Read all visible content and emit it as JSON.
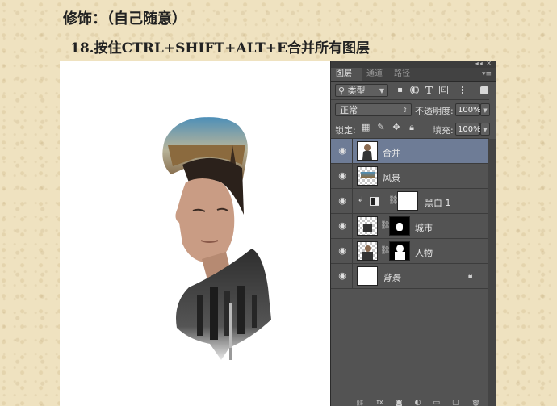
{
  "captions": {
    "line1": "修饰：（自己随意）",
    "line2": "18.按住CTRL+SHIFT+ALT+E合并所有图层"
  },
  "panel": {
    "tabs": [
      {
        "label": "图层",
        "active": true
      },
      {
        "label": "通道",
        "active": false
      },
      {
        "label": "路径",
        "active": false
      }
    ],
    "filter": {
      "kind_label": "类型",
      "icons": [
        "image-filter-icon",
        "adjustment-filter-icon",
        "text-filter-icon",
        "shape-filter-icon",
        "smart-object-filter-icon"
      ]
    },
    "blend": {
      "mode": "正常",
      "opacity_label": "不透明度:",
      "opacity_value": "100%"
    },
    "lock": {
      "label": "锁定:",
      "icons": [
        "lock-transparent-icon",
        "lock-paint-icon",
        "lock-move-icon",
        "lock-all-icon"
      ],
      "fill_label": "填充:",
      "fill_value": "100%"
    },
    "layers": [
      {
        "name": "合并",
        "selected": true,
        "visible": true
      },
      {
        "name": "风景",
        "selected": false,
        "visible": true
      },
      {
        "name": "黑白 1",
        "selected": false,
        "visible": true,
        "adjustment": true
      },
      {
        "name": "城市",
        "selected": false,
        "visible": true,
        "has_mask": true
      },
      {
        "name": "人物",
        "selected": false,
        "visible": true,
        "has_mask": true
      },
      {
        "name": "背景",
        "selected": false,
        "visible": true,
        "locked": true
      }
    ],
    "bottom_icons": [
      "link-layers-icon",
      "fx-icon",
      "add-mask-icon",
      "new-fill-icon",
      "new-group-icon",
      "new-layer-icon",
      "delete-layer-icon"
    ]
  }
}
